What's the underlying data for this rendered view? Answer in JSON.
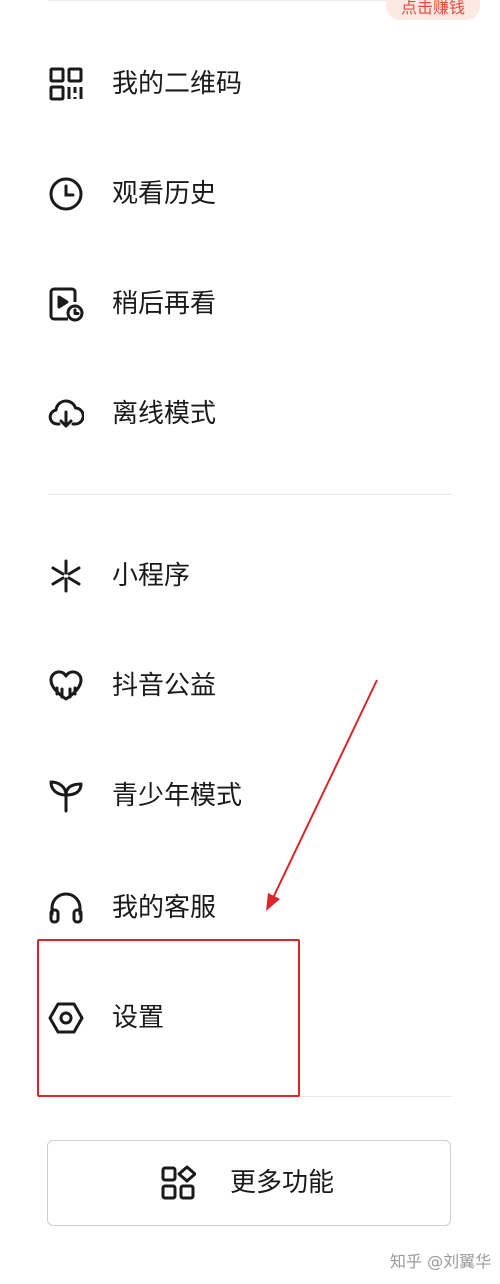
{
  "promo_badge": "点击赚钱",
  "menu": {
    "group1": [
      {
        "label": "我的二维码",
        "icon": "qr-code-icon"
      },
      {
        "label": "观看历史",
        "icon": "clock-icon"
      },
      {
        "label": "稍后再看",
        "icon": "watch-later-icon"
      },
      {
        "label": "离线模式",
        "icon": "cloud-download-icon"
      }
    ],
    "group2": [
      {
        "label": "小程序",
        "icon": "mini-program-icon"
      },
      {
        "label": "抖音公益",
        "icon": "heart-charity-icon"
      },
      {
        "label": "青少年模式",
        "icon": "sprout-icon"
      },
      {
        "label": "我的客服",
        "icon": "headset-icon"
      },
      {
        "label": "设置",
        "icon": "settings-hexagon-icon"
      }
    ]
  },
  "more_features": {
    "label": "更多功能",
    "icon": "grid-shapes-icon"
  },
  "watermark": "知乎 @刘翼华",
  "colors": {
    "annotation": "#d9262a",
    "badge_text": "#f0493e",
    "badge_bg": "#fde9e4"
  }
}
